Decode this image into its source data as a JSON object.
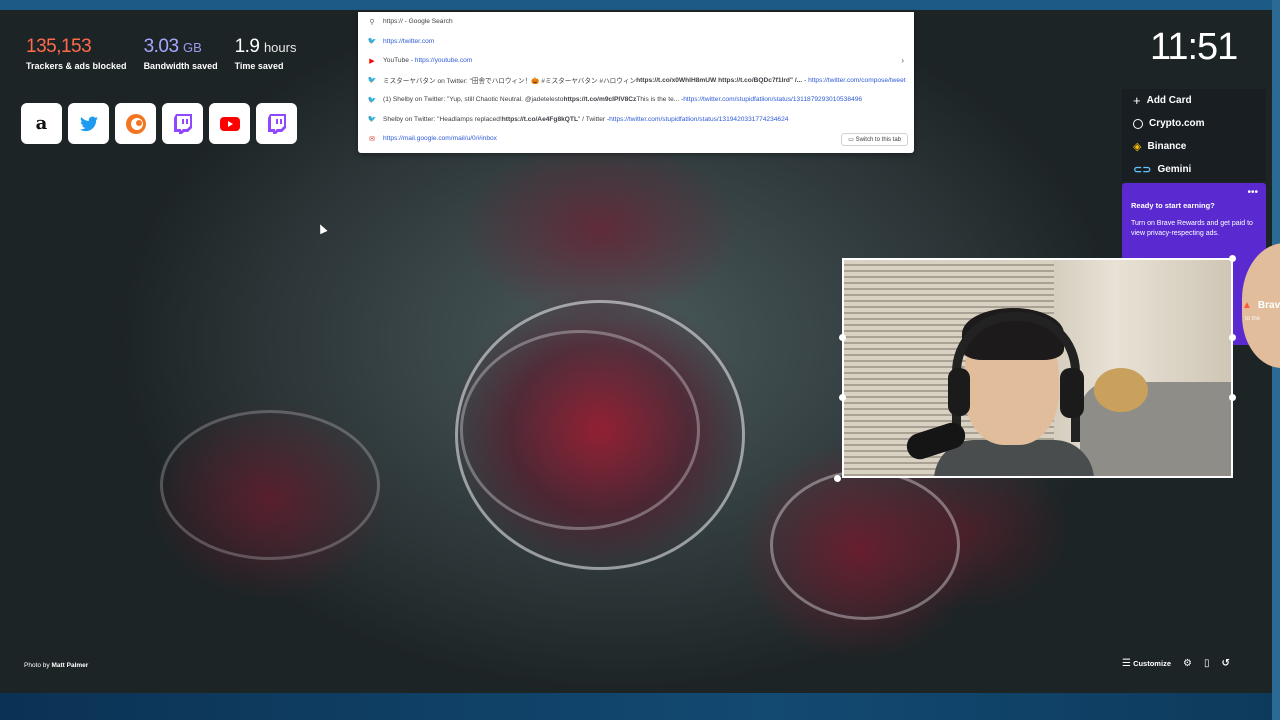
{
  "stats": [
    {
      "value": "135,153",
      "unit": "",
      "label": "Trackers & ads blocked"
    },
    {
      "value": "3.03",
      "unit": "GB",
      "label": "Bandwidth saved"
    },
    {
      "value": "1.9",
      "unit": "hours",
      "label": "Time saved"
    }
  ],
  "top_sites": [
    {
      "icon": "amazon-icon",
      "glyph": "a"
    },
    {
      "icon": "twitter-icon",
      "glyph": "🐦"
    },
    {
      "icon": "crunchyroll-icon",
      "glyph": "C"
    },
    {
      "icon": "twitch-icon",
      "glyph": "▣"
    },
    {
      "icon": "youtube-icon",
      "glyph": "▶"
    },
    {
      "icon": "twitch-icon",
      "glyph": "▣"
    }
  ],
  "clock": "11:51",
  "omnibox": {
    "rows": [
      {
        "icon": "search-icon",
        "text": "https:// - Google Search"
      },
      {
        "icon": "twitter-icon",
        "link": "https://twitter.com"
      },
      {
        "icon": "youtube-icon",
        "text": "YouTube - ",
        "link": "https://youtube.com"
      },
      {
        "icon": "twitter-icon",
        "text": "ミスターヤバタン on Twitter: \"田舎でハロウィン！🎃 #ミスターヤバタン #ハロウィン ",
        "bold": "https://t.co/x0WhlH8mUW https://t.co/BQDc7f1lrd\" /...",
        "link": "https://twitter.com/compose/tweet"
      },
      {
        "icon": "twitter-icon",
        "text": "(1) Shelby on Twitter: \"Yup, still Chaotic Neutral. @jadetelesto ",
        "bold": "https://t.co/m9cIPIV8Cz",
        "text2": " This is the te... - ",
        "link": "https://twitter.com/stupidfatlion/status/1311879293010538496"
      },
      {
        "icon": "twitter-icon",
        "text": "Shelby on Twitter: \"Headlamps replaced! ",
        "bold": "https://t.co/Ae4Fg8kQTL",
        "text2": "\" / Twitter - ",
        "link": "https://twitter.com/stupidfatlion/status/1319420331774234624"
      },
      {
        "icon": "gmail-icon",
        "link": "https://mail.google.com/mail/u/0/#inbox"
      }
    ],
    "switch_label": "Switch to this tab"
  },
  "widgets": {
    "add_card": "Add Card",
    "items": [
      "Crypto.com",
      "Binance",
      "Gemini"
    ],
    "rewards": {
      "title": "Brave Rewards",
      "question": "Ready to start earning?",
      "body": "Turn on Brave Rewards and get paid to view privacy-respecting ads.",
      "tail": "to the"
    }
  },
  "photo_credit": {
    "prefix": "Photo by ",
    "author": "Matt Palmer"
  },
  "customize_label": "Customize"
}
